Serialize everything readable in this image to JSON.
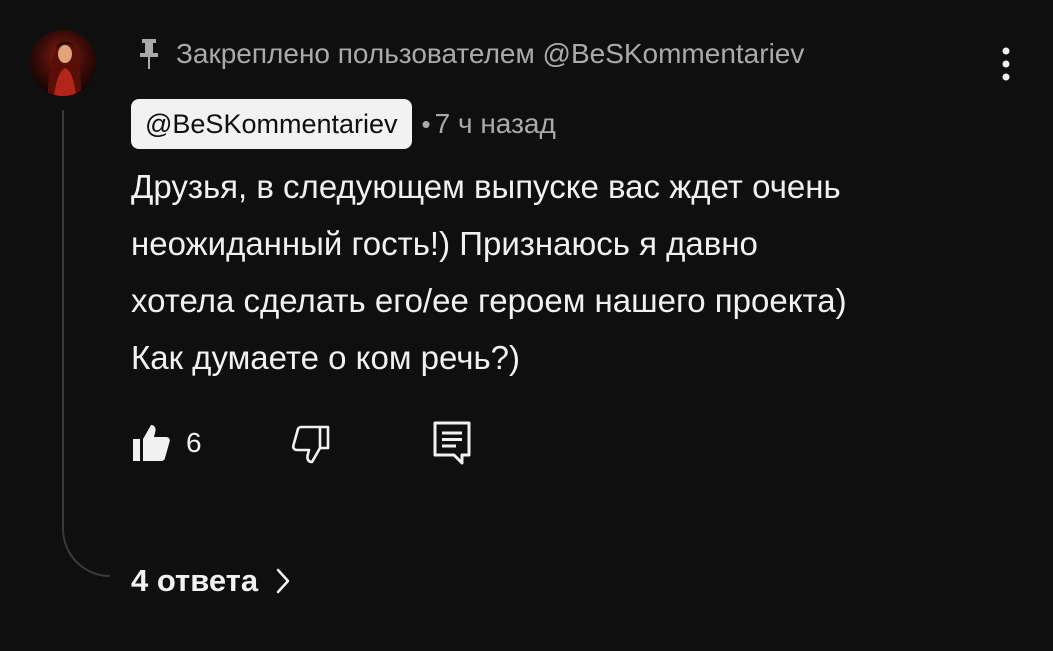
{
  "comment": {
    "pinned_text": "Закреплено пользователем @BeSKommentariev",
    "author": "@BeSKommentariev",
    "separator": "•",
    "timestamp": "7 ч назад",
    "text": "Друзья, в следующем выпуске вас ждет очень\nнеожиданный гость!) Признаюсь я давно\nхотела сделать его/ее героем нашего проекта)\nКак думаете о ком речь?)",
    "like_count": "6",
    "replies_label": "4 ответа"
  },
  "icons": {
    "pin": "pin-icon",
    "more": "more-vertical-icon",
    "like": "thumb-up-icon",
    "dislike": "thumb-down-icon",
    "reply": "reply-icon",
    "chevron": "chevron-right-icon"
  },
  "colors": {
    "background": "#0f0f0f",
    "text_primary": "#f1f1f1",
    "text_secondary": "#aaaaaa",
    "author_chip_bg": "#f2f2f2"
  }
}
